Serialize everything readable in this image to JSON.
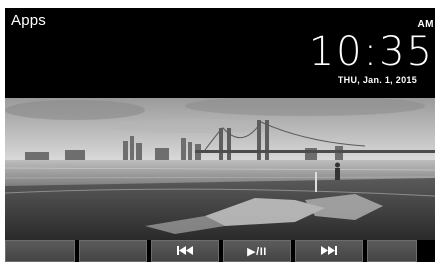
{
  "app": {
    "title": "Apps"
  },
  "clock": {
    "time": "10:35",
    "ampm": "AM",
    "date": "THU, Jan. 1, 2015"
  },
  "wallpaper": {
    "scene": "bridge-skyline-waterfront"
  },
  "controls": {
    "buttons": [
      {
        "label": "",
        "icon": "blank"
      },
      {
        "label": "",
        "icon": "blank"
      },
      {
        "label": "",
        "icon": "previous-track-icon"
      },
      {
        "label": "▶/II",
        "icon": "play-pause-icon"
      },
      {
        "label": "",
        "icon": "next-track-icon"
      },
      {
        "label": "",
        "icon": "blank"
      }
    ]
  }
}
